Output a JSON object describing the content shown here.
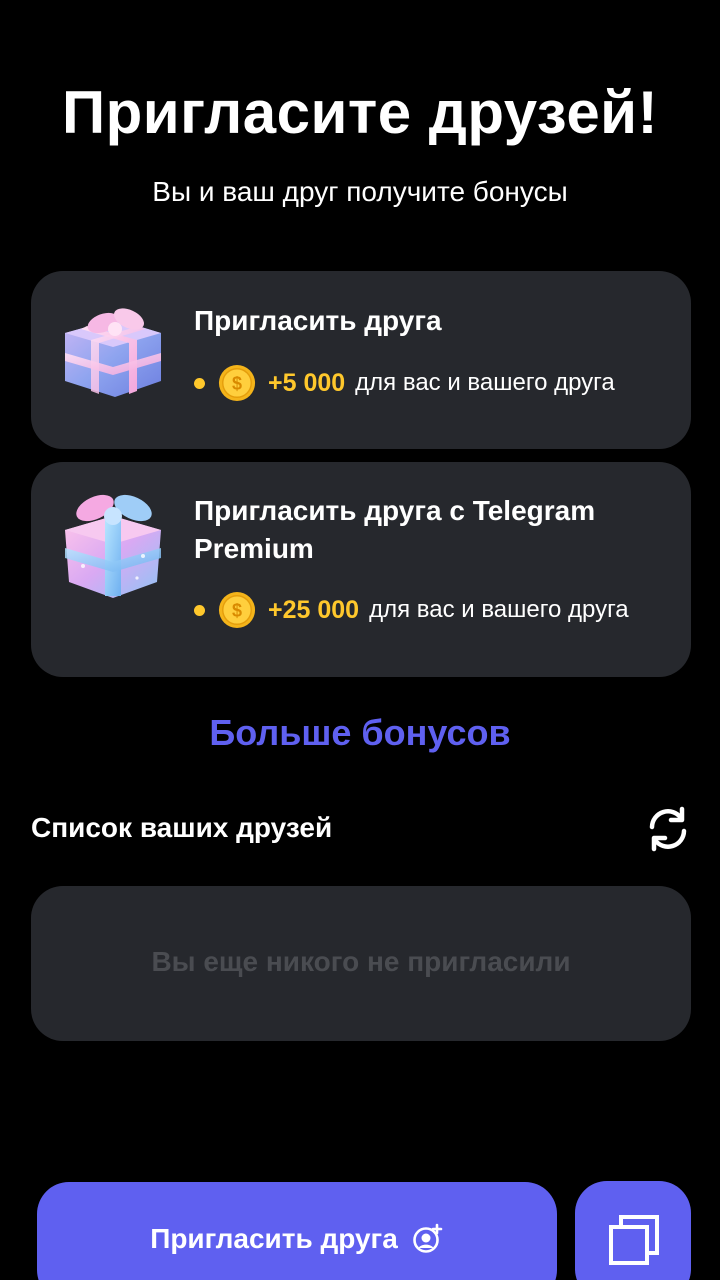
{
  "header": {
    "title": "Пригласите друзей!",
    "subtitle": "Вы и ваш друг получите бонусы"
  },
  "offers": [
    {
      "title": "Пригласить друга",
      "amount": "+5 000",
      "description": "для вас и вашего друга",
      "icon": "gift-icon"
    },
    {
      "title": "Пригласить друга с Telegram Premium",
      "amount": "+25 000",
      "description": "для вас и вашего друга",
      "icon": "gift-icon"
    }
  ],
  "more_bonuses_label": "Больше бонусов",
  "friends": {
    "title": "Список ваших друзей",
    "empty_text": "Вы еще никого не пригласили",
    "refresh_icon": "refresh-icon"
  },
  "actions": {
    "invite_label": "Пригласить друга",
    "invite_icon": "add-user-icon",
    "copy_icon": "copy-icon"
  },
  "colors": {
    "background": "#000000",
    "card": "#26282d",
    "accent": "#5f60f0",
    "coin": "#ffc82c",
    "muted_text": "#4a4c51"
  }
}
